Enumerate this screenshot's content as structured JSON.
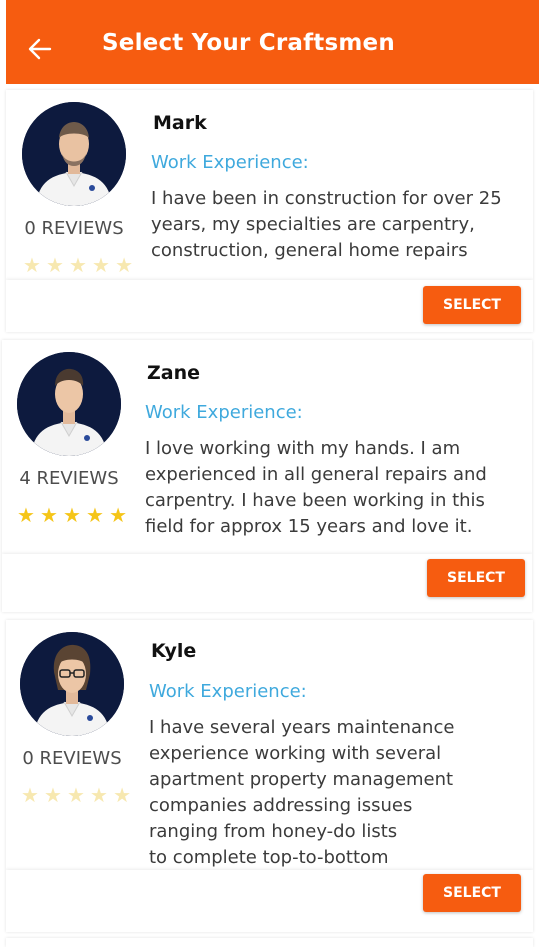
{
  "header": {
    "title": "Select Your Craftsmen",
    "background": "#f65c10"
  },
  "craftsmen": [
    {
      "name": "Mark",
      "reviews_label": "0 REVIEWS",
      "rating": 0,
      "experience_label": "Work Experience:",
      "experience_lines": [
        "I have been in construction for over 25",
        "years, my specialties are carpentry,",
        "construction, general home repairs"
      ],
      "select_label": "SELECT"
    },
    {
      "name": "Zane",
      "reviews_label": "4 REVIEWS",
      "rating": 5,
      "experience_label": "Work Experience:",
      "experience_lines": [
        "I love working with my hands. I am",
        "experienced in all general repairs and",
        "carpentry. I have been working in this",
        "field for approx 15 years and love it."
      ],
      "select_label": "SELECT"
    },
    {
      "name": "Kyle",
      "reviews_label": "0 REVIEWS",
      "rating": 0,
      "experience_label": "Work Experience:",
      "experience_lines": [
        "I have several years maintenance",
        "experience working with several",
        "apartment property management",
        "companies addressing issues",
        "ranging from honey-do lists",
        "to complete top-to-bottom"
      ],
      "select_label": "SELECT"
    }
  ],
  "colors": {
    "accent": "#f65c10",
    "experience_label": "#3fa9dd",
    "star_filled": "#f5c518",
    "star_empty": "#f7e8b0"
  }
}
